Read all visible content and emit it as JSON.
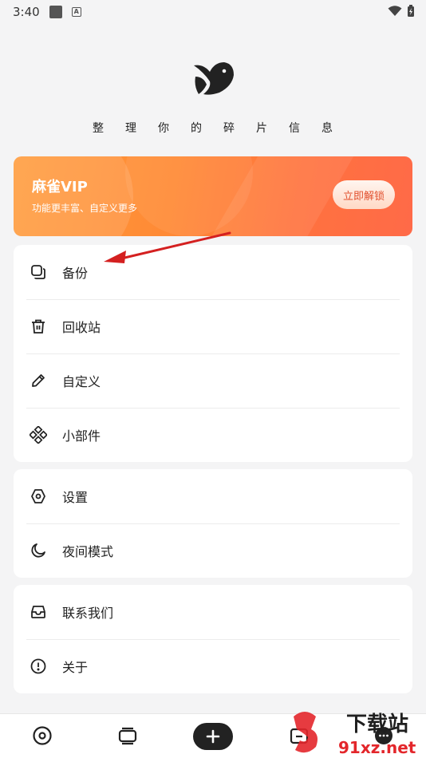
{
  "status_bar": {
    "time": "3:40"
  },
  "app": {
    "slogan": "整理你的碎片信息"
  },
  "vip": {
    "title": "麻雀VIP",
    "subtitle": "功能更丰富、自定义更多",
    "button_label": "立即解锁",
    "colors": {
      "start": "#ff9b3b",
      "end": "#ff6a48",
      "button_text": "#e2502e"
    }
  },
  "menu_groups": [
    {
      "items": [
        {
          "label": "备份",
          "icon": "backup-copy-icon"
        },
        {
          "label": "回收站",
          "icon": "trash-icon"
        },
        {
          "label": "自定义",
          "icon": "pencil-icon"
        },
        {
          "label": "小部件",
          "icon": "widgets-icon"
        }
      ]
    },
    {
      "items": [
        {
          "label": "设置",
          "icon": "settings-icon"
        },
        {
          "label": "夜间模式",
          "icon": "moon-icon"
        }
      ]
    },
    {
      "items": [
        {
          "label": "联系我们",
          "icon": "inbox-icon"
        },
        {
          "label": "关于",
          "icon": "info-icon"
        }
      ]
    }
  ],
  "bottom_nav": [
    {
      "icon": "record-icon"
    },
    {
      "icon": "cards-icon"
    },
    {
      "icon": "add-icon"
    },
    {
      "icon": "folder-icon"
    },
    {
      "icon": "chat-icon"
    }
  ],
  "watermark": {
    "line1": "下载站",
    "line2": "91xz.net"
  }
}
